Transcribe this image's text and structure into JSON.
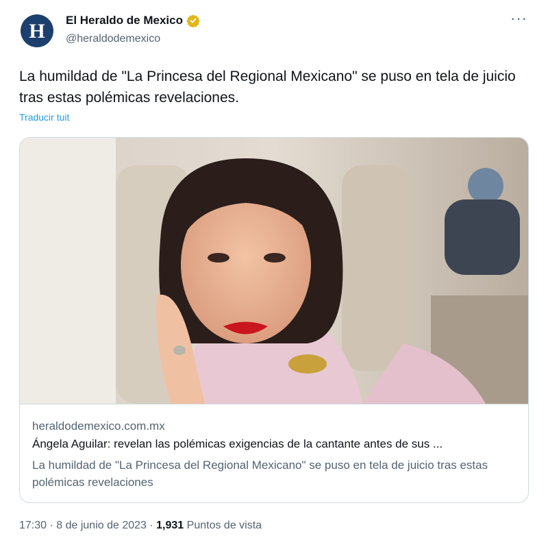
{
  "account": {
    "avatar_letter": "H",
    "display_name": "El Heraldo de Mexico",
    "handle": "@heraldodemexico",
    "verified_color": "#e2b719"
  },
  "tweet": {
    "text": "La humildad de \"La Princesa del Regional Mexicano\" se puso en tela de juicio tras estas polémicas revelaciones.",
    "translate_label": "Traducir tuit"
  },
  "card": {
    "domain": "heraldodemexico.com.mx",
    "title": "Ángela Aguilar: revelan las polémicas exigencias de la cantante antes de sus ...",
    "description": "La humildad de \"La Princesa del Regional Mexicano\" se puso en tela de juicio tras estas polémicas revelaciones"
  },
  "meta": {
    "time": "17:30",
    "separator": " · ",
    "date": "8 de junio de 2023",
    "views_count": "1,931",
    "views_label": "Puntos de vista"
  },
  "icons": {
    "more": "more-options-icon",
    "verified": "verified-badge-icon"
  }
}
